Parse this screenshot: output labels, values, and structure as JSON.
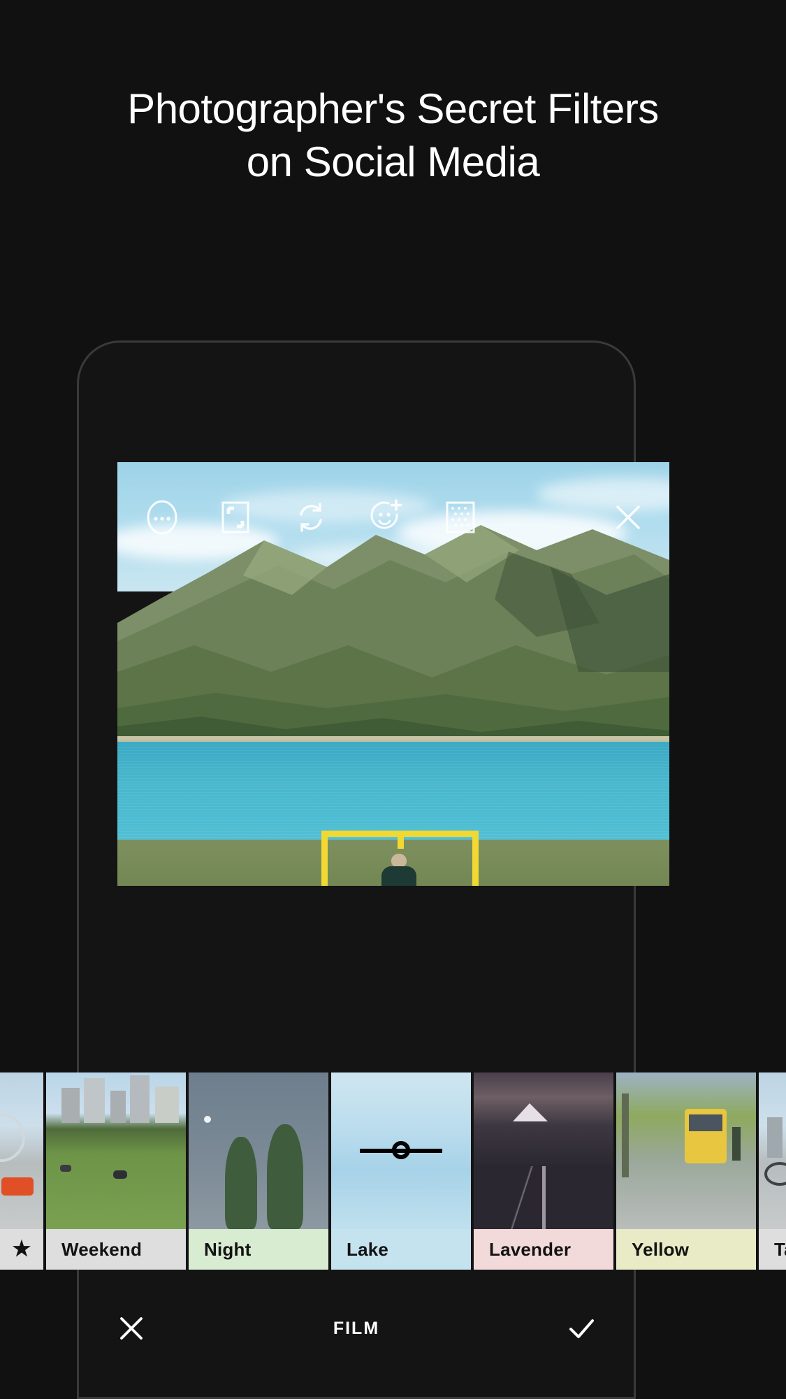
{
  "headline": {
    "line1": "Photographer's Secret Filters",
    "line2": "on Social Media"
  },
  "editor": {
    "toolbar": [
      {
        "name": "more-options-icon",
        "label": "More options"
      },
      {
        "name": "crop-icon",
        "label": "Crop"
      },
      {
        "name": "rotate-icon",
        "label": "Rotate"
      },
      {
        "name": "add-sticker-icon",
        "label": "Add sticker"
      },
      {
        "name": "grain-icon",
        "label": "Grain"
      }
    ],
    "close_label": "Close",
    "focus_frame_color": "#f2d832"
  },
  "filters": {
    "items": [
      {
        "label": "",
        "icon": "star-icon",
        "label_bg": "#dedede",
        "thumb": "taxi-street"
      },
      {
        "label": "Weekend",
        "label_bg": "#dedede",
        "thumb": "city-park"
      },
      {
        "label": "Night",
        "label_bg": "#d8ecd2",
        "thumb": "night-trees"
      },
      {
        "label": "Lake",
        "label_bg": "#c5e2ef",
        "thumb": "lake-sky"
      },
      {
        "label": "Lavender",
        "label_bg": "#f3dada",
        "thumb": "mountain-road"
      },
      {
        "label": "Yellow",
        "label_bg": "#e8ebc6",
        "thumb": "yellow-tram"
      },
      {
        "label": "Taxi",
        "label_bg": "#dedede",
        "thumb": "taxi-street-2"
      }
    ],
    "selected": "Lake"
  },
  "bottom_bar": {
    "cancel_label": "Cancel",
    "title": "FILM",
    "confirm_label": "Confirm"
  },
  "colors": {
    "background": "#111111",
    "accent_yellow": "#f2d832",
    "text_primary": "#ffffff"
  }
}
